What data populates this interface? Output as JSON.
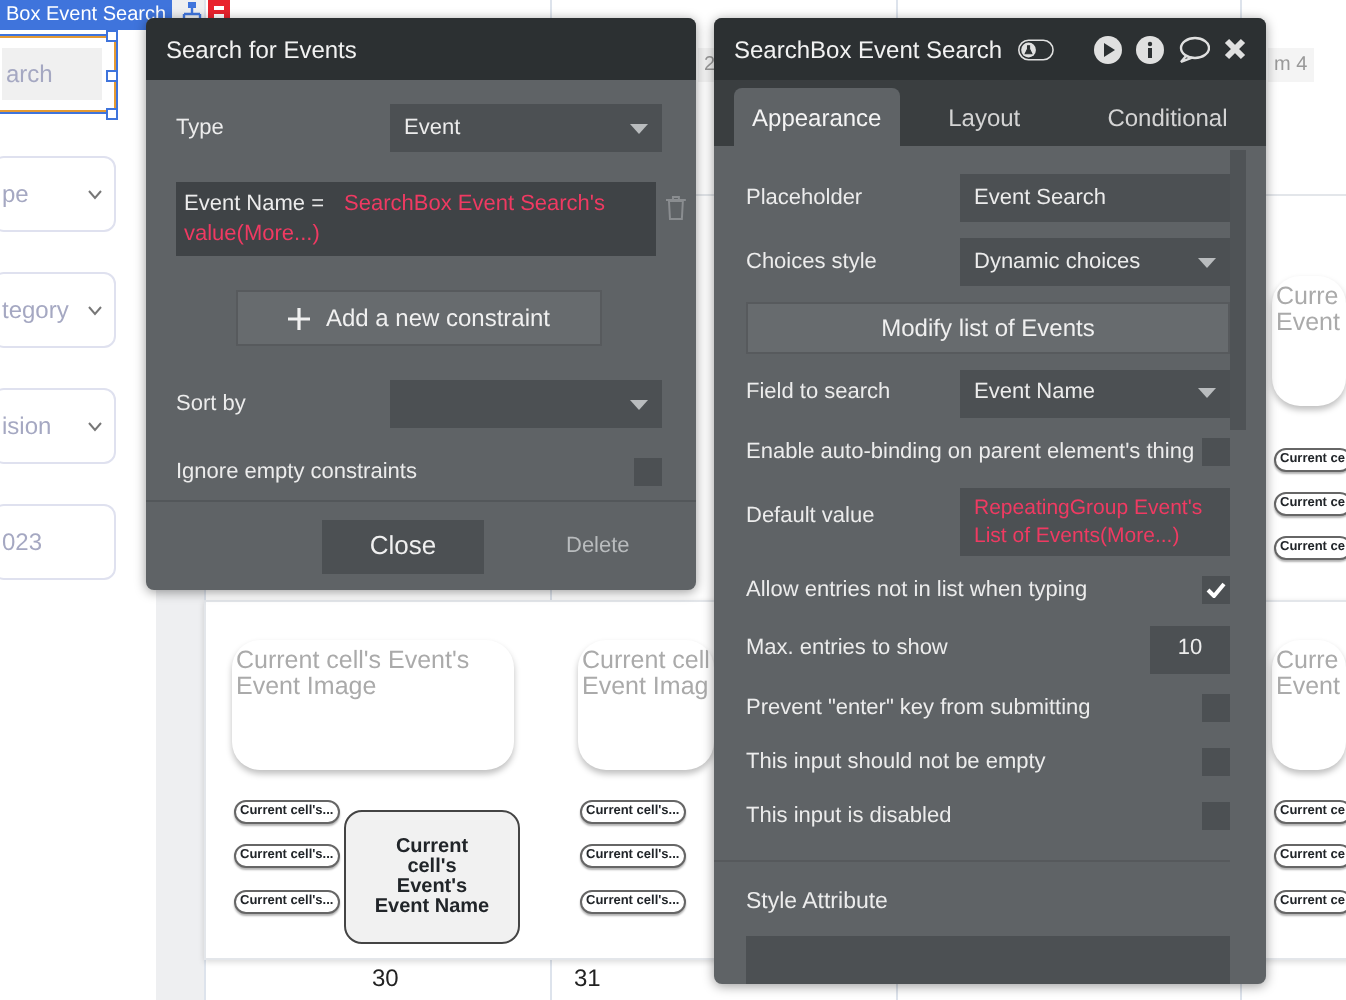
{
  "canvas": {
    "element_tag": {
      "label": "Box Event Search"
    },
    "inputs": [
      {
        "kind": "search",
        "text": "arch",
        "selected": true
      },
      {
        "kind": "dropdown",
        "text": "pe",
        "selected": false
      },
      {
        "kind": "dropdown",
        "text": "tegory",
        "selected": false
      },
      {
        "kind": "dropdown",
        "text": "ision",
        "selected": false
      },
      {
        "kind": "date",
        "text": "023",
        "selected": false
      }
    ],
    "header_labels": [
      "2",
      "m 4"
    ],
    "cards": [
      {
        "image_lines": [
          "Curre",
          "Event"
        ],
        "pills": [
          "Current ce",
          "Current ce",
          "Current ce"
        ]
      },
      {
        "image_lines": [
          "Current cell's Event's",
          "Event Image"
        ],
        "pills": [
          "Current cell's...",
          "Current cell's...",
          "Current cell's..."
        ],
        "name": "Current cell's Event's Event Name"
      },
      {
        "image_lines": [
          "Current cell",
          "Event Imag"
        ],
        "pills": [
          "Current cell's...",
          "Current cell's...",
          "Current cell's..."
        ]
      },
      {
        "image_lines": [
          "Curre",
          "Event"
        ],
        "pills": [
          "Current ce",
          "Current ce",
          "Current ce"
        ]
      }
    ],
    "day_numbers": [
      "30",
      "31"
    ]
  },
  "search_dialog": {
    "title": "Search for Events",
    "type": {
      "label": "Type",
      "value": "Event"
    },
    "constraint": {
      "field": "Event Name =",
      "value": "SearchBox Event Search's value(More...)"
    },
    "add_button": "Add a new constraint",
    "sort_by": {
      "label": "Sort by"
    },
    "ignore_empty": {
      "label": "Ignore empty constraints",
      "checked": false
    },
    "close_button": "Close",
    "delete_button": "Delete"
  },
  "property_editor": {
    "title": "SearchBox Event Search",
    "tabs": [
      {
        "label": "Appearance",
        "selected": true
      },
      {
        "label": "Layout",
        "selected": false
      },
      {
        "label": "Conditional",
        "selected": false
      }
    ],
    "rows": [
      {
        "kind": "field",
        "label": "Placeholder",
        "value": "Event Search"
      },
      {
        "kind": "dropdown",
        "label": "Choices style",
        "value": "Dynamic choices"
      },
      {
        "kind": "button",
        "label": "Modify list of Events"
      },
      {
        "kind": "dropdown",
        "label": "Field to search",
        "value": "Event Name"
      },
      {
        "kind": "checkbox",
        "label": "Enable auto-binding on parent element's thing",
        "checked": false
      },
      {
        "kind": "expression",
        "label": "Default value",
        "value": "RepeatingGroup Event's List of Events(More...)"
      },
      {
        "kind": "checkbox",
        "label": "Allow entries not in list when typing",
        "checked": true
      },
      {
        "kind": "number",
        "label": "Max. entries to show",
        "value": "10"
      },
      {
        "kind": "checkbox",
        "label": "Prevent \"enter\" key from submitting",
        "checked": false
      },
      {
        "kind": "checkbox",
        "label": "This input should not be empty",
        "checked": false
      },
      {
        "kind": "checkbox",
        "label": "This input is disabled",
        "checked": false
      },
      {
        "kind": "section",
        "label": "Style Attribute"
      },
      {
        "kind": "cut_dropdown"
      }
    ]
  }
}
